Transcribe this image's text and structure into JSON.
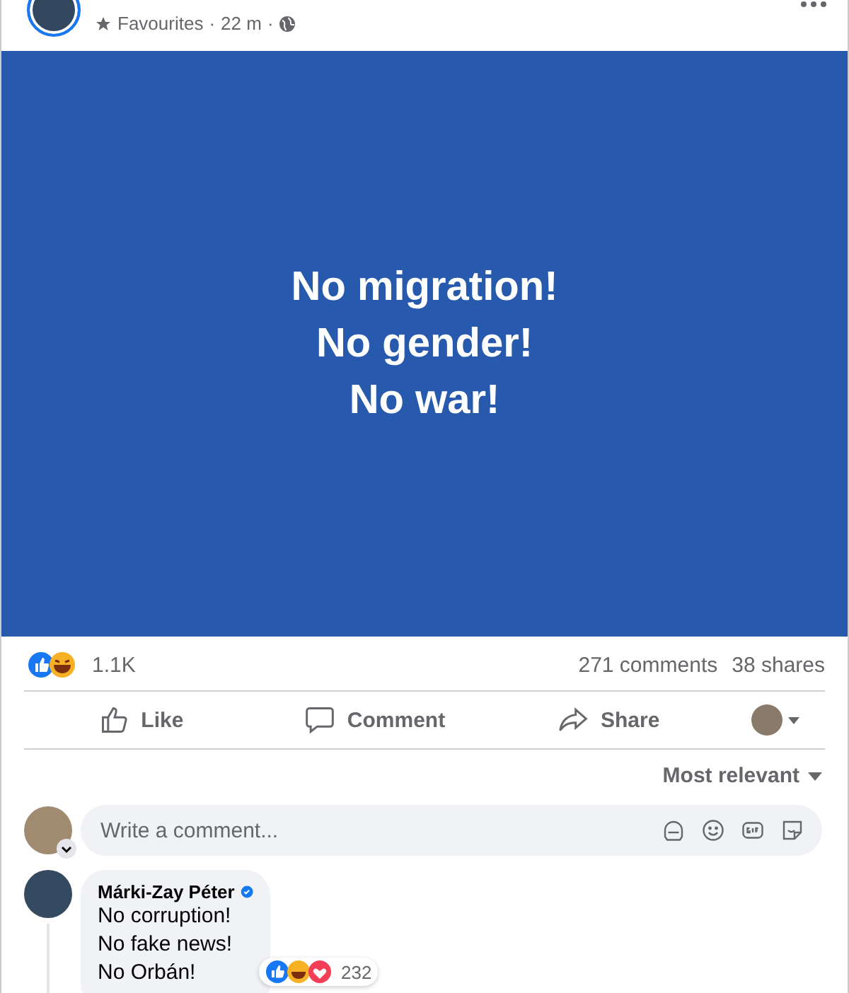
{
  "post": {
    "audience": "Favourites",
    "separator": "·",
    "time": "22 m",
    "image_lines": [
      "No migration!",
      "No gender!",
      "No war!"
    ]
  },
  "stats": {
    "reactions": "1.1K",
    "comments": "271 comments",
    "shares": "38 shares"
  },
  "actions": [
    {
      "kind": "like",
      "label": "Like"
    },
    {
      "kind": "comment",
      "label": "Comment"
    },
    {
      "kind": "share",
      "label": "Share"
    }
  ],
  "sort": "Most relevant",
  "composer": {
    "placeholder": "Write a comment..."
  },
  "comments": [
    {
      "author": "Márki-Zay Péter",
      "verified": true,
      "lines": [
        "No corruption!",
        "No fake news!",
        "No Orbán!"
      ],
      "reactions": "232"
    }
  ]
}
